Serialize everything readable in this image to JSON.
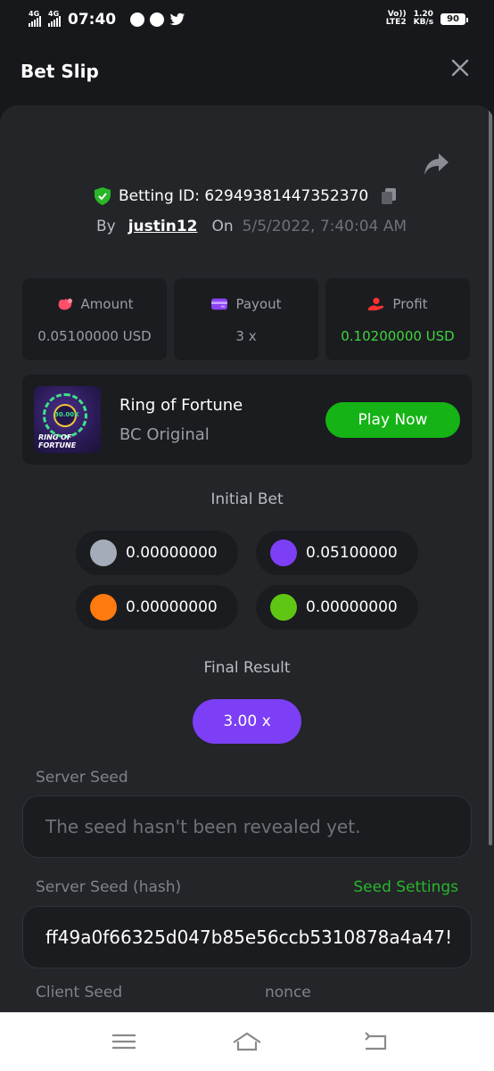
{
  "status_bar": {
    "network_1": "4G",
    "network_2": "4G",
    "time": "07:40",
    "volte_line1": "Vo))",
    "volte_line2": "LTE2",
    "speed_value": "1.20",
    "speed_unit": "KB/s",
    "battery": "90"
  },
  "header": {
    "title": "Bet Slip"
  },
  "bet": {
    "id_label": "Betting ID: 62949381447352370",
    "by_label": "By",
    "username": "justin12",
    "on_label": "On",
    "date": "5/5/2022, 7:40:04 AM"
  },
  "stats": [
    {
      "label": "Amount",
      "value": "0.05100000 USD",
      "icon": "money-bag-icon",
      "color": "#ff4d6a"
    },
    {
      "label": "Payout",
      "value": "3 x",
      "icon": "wallet-icon",
      "color": "#8b43f5"
    },
    {
      "label": "Profit",
      "value": "0.10200000 USD",
      "icon": "coin-hand-icon",
      "color": "#ff3030"
    }
  ],
  "game": {
    "name": "Ring of Fortune",
    "subtitle": "BC Original",
    "thumb_value": "30.00X",
    "thumb_logo_line1": "RING OF",
    "thumb_logo_line2": "FORTUNE",
    "play_label": "Play Now"
  },
  "initial_bet": {
    "title": "Initial Bet",
    "chips": [
      {
        "value": "0.00000000",
        "color": "#a3acb8"
      },
      {
        "value": "0.05100000",
        "color": "#7c3ff5"
      },
      {
        "value": "0.00000000",
        "color": "#ff7a0f"
      },
      {
        "value": "0.00000000",
        "color": "#5fc714"
      }
    ]
  },
  "final_result": {
    "title": "Final Result",
    "value": "3.00 x"
  },
  "seeds": {
    "server_seed_label": "Server Seed",
    "server_seed_placeholder": "The seed hasn't been revealed yet.",
    "server_hash_label": "Server Seed (hash)",
    "seed_settings_label": "Seed Settings",
    "server_hash_value": "ff49a0f66325d047b85e56ccb5310878a4a47!",
    "client_seed_label": "Client Seed",
    "nonce_label": "nonce"
  }
}
